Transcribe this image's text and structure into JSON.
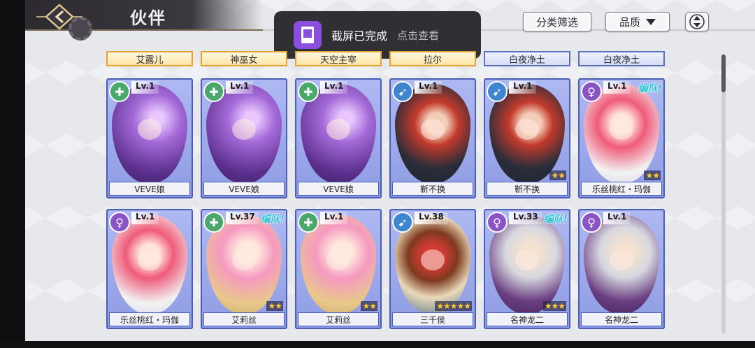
{
  "header": {
    "title": "伙伴",
    "filter_label": "分类筛选",
    "quality_label": "品质"
  },
  "toast": {
    "message": "截屏已完成",
    "action": "点击查看"
  },
  "tags": [
    {
      "label": "艾露儿",
      "style": "gold"
    },
    {
      "label": "神巫女",
      "style": "gold"
    },
    {
      "label": "天空主宰",
      "style": "gold"
    },
    {
      "label": "拉尔",
      "style": "gold"
    },
    {
      "label": "白夜净土",
      "style": "blue"
    },
    {
      "label": "白夜净土",
      "style": "blue"
    }
  ],
  "cards": [
    {
      "name": "VEVE娘",
      "level": "Lv.1",
      "class": "green",
      "art": "purple",
      "stars": 0,
      "team": ""
    },
    {
      "name": "VEVE娘",
      "level": "Lv.1",
      "class": "green",
      "art": "purple",
      "stars": 0,
      "team": ""
    },
    {
      "name": "VEVE娘",
      "level": "Lv.1",
      "class": "green",
      "art": "purple",
      "stars": 0,
      "team": ""
    },
    {
      "name": "靳不换",
      "level": "Lv.1",
      "class": "blue",
      "art": "redhat",
      "stars": 0,
      "team": ""
    },
    {
      "name": "靳不换",
      "level": "Lv.1",
      "class": "blue",
      "art": "redhat",
      "stars": 2,
      "team": ""
    },
    {
      "name": "乐丝桃红・玛伽",
      "level": "Lv.1",
      "class": "purple",
      "art": "pinkmaid",
      "stars": 2,
      "team": "编队!"
    },
    {
      "name": "乐丝桃红・玛伽",
      "level": "Lv.1",
      "class": "purple",
      "art": "pinkmaid",
      "stars": 0,
      "team": ""
    },
    {
      "name": "艾莉丝",
      "level": "Lv.37",
      "class": "green",
      "art": "pinkhorn",
      "stars": 2,
      "team": "编队!"
    },
    {
      "name": "艾莉丝",
      "level": "Lv.1",
      "class": "green",
      "art": "pinkhorn",
      "stars": 2,
      "team": ""
    },
    {
      "name": "三千侯",
      "level": "Lv.38",
      "class": "blue",
      "art": "beast",
      "stars": 5,
      "team": ""
    },
    {
      "name": "名神龙二",
      "level": "Lv.33",
      "class": "purple",
      "art": "silver",
      "stars": 3,
      "team": "编队!"
    },
    {
      "name": "名神龙二",
      "level": "Lv.1",
      "class": "purple",
      "art": "silver",
      "stars": 0,
      "team": ""
    }
  ],
  "icons": {
    "back": "diamond-back-icon",
    "sort": "sort-updown-icon",
    "toast": "screenshot-doc-icon"
  }
}
